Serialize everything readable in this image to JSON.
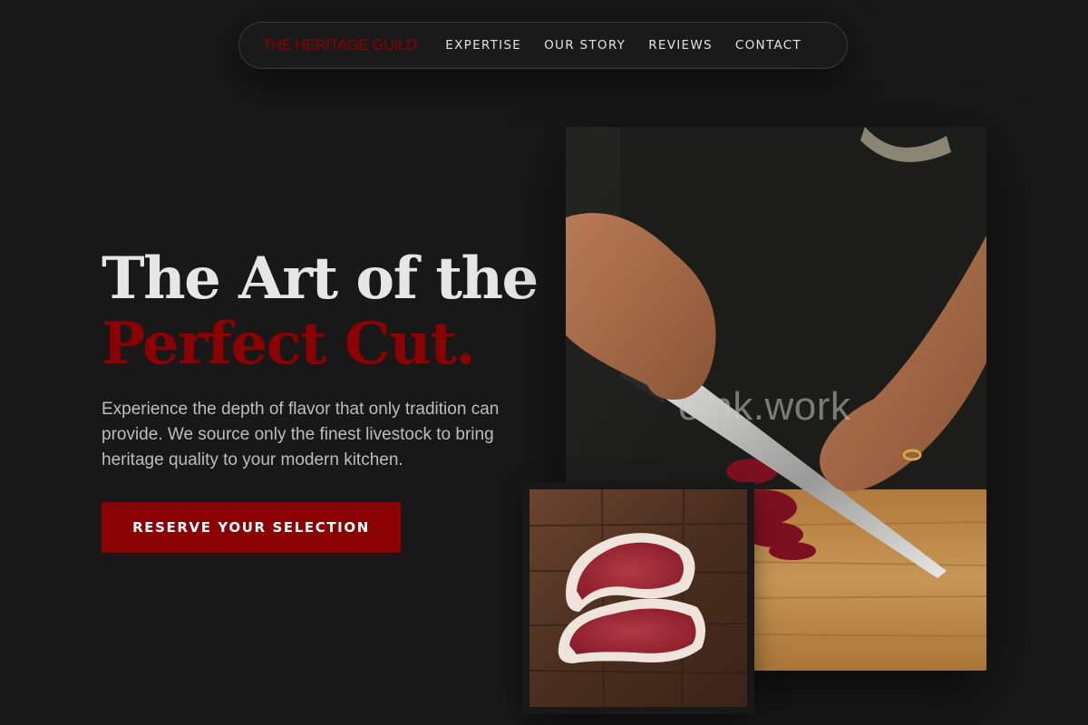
{
  "nav": {
    "brand": "THE HERITAGE GUILD",
    "links": [
      "EXPERTISE",
      "OUR STORY",
      "REVIEWS",
      "CONTACT"
    ]
  },
  "hero": {
    "title_line1": "The Art of the",
    "title_line2": "Perfect Cut.",
    "description": "Experience the depth of flavor that only tradition can provide. We source only the finest livestock to bring heritage quality to your modern kitchen.",
    "cta_label": "RESERVE YOUR SELECTION"
  },
  "watermark": "oink.work",
  "colors": {
    "background": "#181818",
    "accent": "#8b0000",
    "text": "#e6e6e6",
    "muted_text": "#bdbdbd"
  }
}
